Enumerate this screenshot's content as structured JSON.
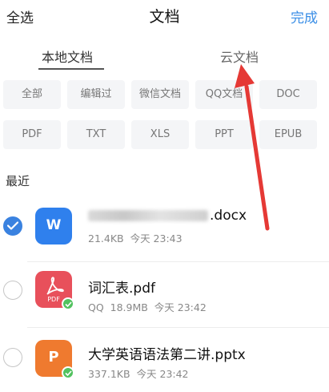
{
  "header": {
    "select_all": "全选",
    "title": "文档",
    "done": "完成"
  },
  "tabs": [
    {
      "label": "本地文档",
      "active": true
    },
    {
      "label": "云文档",
      "active": false
    }
  ],
  "filters": [
    "全部",
    "编辑过",
    "微信文档",
    "QQ文档",
    "DOC",
    "PDF",
    "TXT",
    "XLS",
    "PPT",
    "EPUB"
  ],
  "section": {
    "recent": "最近"
  },
  "files": [
    {
      "name": ".docx",
      "size": "21.4KB",
      "time": "今天 23:43",
      "source": "",
      "icon_label": "W",
      "icon_color": "#2f80ed",
      "checked": true
    },
    {
      "name": "词汇表.pdf",
      "size": "18.9MB",
      "time": "今天 23:42",
      "source": "QQ",
      "icon_label": "PDF",
      "icon_color": "#e8505b",
      "checked": false
    },
    {
      "name": "大学英语语法第二讲.pptx",
      "size": "337.1KB",
      "time": "今天 23:42",
      "source": "",
      "icon_label": "P",
      "icon_color": "#ef7a2f",
      "checked": false
    }
  ],
  "colors": {
    "accent": "#3a8ee6",
    "annotation_arrow": "#e53935"
  },
  "icons": [
    "check-icon",
    "word-file-icon",
    "pdf-file-icon",
    "ppt-file-icon",
    "synced-badge-icon"
  ]
}
